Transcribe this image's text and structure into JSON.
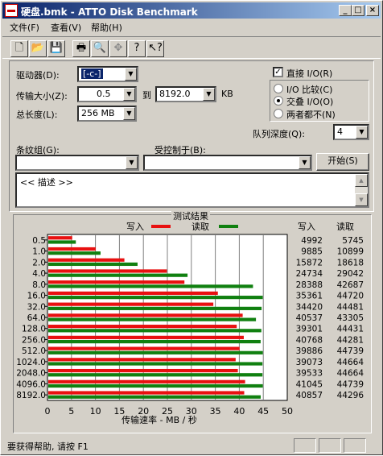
{
  "title": "硬盘.bmk - ATTO Disk Benchmark",
  "menu": [
    "文件(F)",
    "查看(V)",
    "帮助(H)"
  ],
  "toolbar_icons": [
    "new-icon",
    "open-icon",
    "save-icon",
    "print-icon",
    "print-preview-icon",
    "move-icon",
    "help-icon",
    "context-help-icon"
  ],
  "form": {
    "drive_label": "驱动器(D):",
    "drive_value": "[-c-]",
    "transfer_label": "传输大小(Z):",
    "transfer_from": "0.5",
    "to_label": "到",
    "transfer_to": "8192.0",
    "kb_label": "KB",
    "total_label": "总长度(L):",
    "total_value": "256 MB",
    "direct_io_label": "直接 I/O(R)",
    "io_compare_label": "I/O 比较(C)",
    "overlap_io_label": "交叠 I/O(O)",
    "neither_label": "两者都不(N)",
    "queue_label": "队列深度(Q):",
    "queue_value": "4",
    "stripe_label": "条纹组(G):",
    "controlled_label": "受控制于(B):",
    "start_button": "开始(S)",
    "description": "<< 描述 >>"
  },
  "results": {
    "title": "测试结果",
    "write_label": "写入",
    "read_label": "读取",
    "xlabel": "传输速率 - MB / 秒"
  },
  "chart_data": {
    "type": "bar",
    "title": "测试结果",
    "xlabel": "传输速率 - MB / 秒",
    "categories": [
      "0.5",
      "1.0",
      "2.0",
      "4.0",
      "8.0",
      "16.0",
      "32.0",
      "64.0",
      "128.0",
      "256.0",
      "512.0",
      "1024.0",
      "2048.0",
      "4096.0",
      "8192.0"
    ],
    "series": [
      {
        "name": "写入",
        "color": "#e81010",
        "values": [
          4992,
          9885,
          15872,
          24734,
          28388,
          35361,
          34420,
          40537,
          39301,
          40768,
          39886,
          39073,
          39533,
          41045,
          40857
        ]
      },
      {
        "name": "读取",
        "color": "#108010",
        "values": [
          5745,
          10899,
          18618,
          29042,
          42687,
          44720,
          44481,
          43305,
          44431,
          44281,
          44739,
          44664,
          44664,
          44739,
          44296
        ]
      }
    ],
    "xlim": [
      0,
      50
    ],
    "xticks": [
      "0",
      "5",
      "10",
      "15",
      "20",
      "25",
      "30",
      "35",
      "40",
      "45",
      "50"
    ],
    "bar_unit_divisor": 1000,
    "grid": true
  },
  "status": "要获得帮助, 请按 F1"
}
